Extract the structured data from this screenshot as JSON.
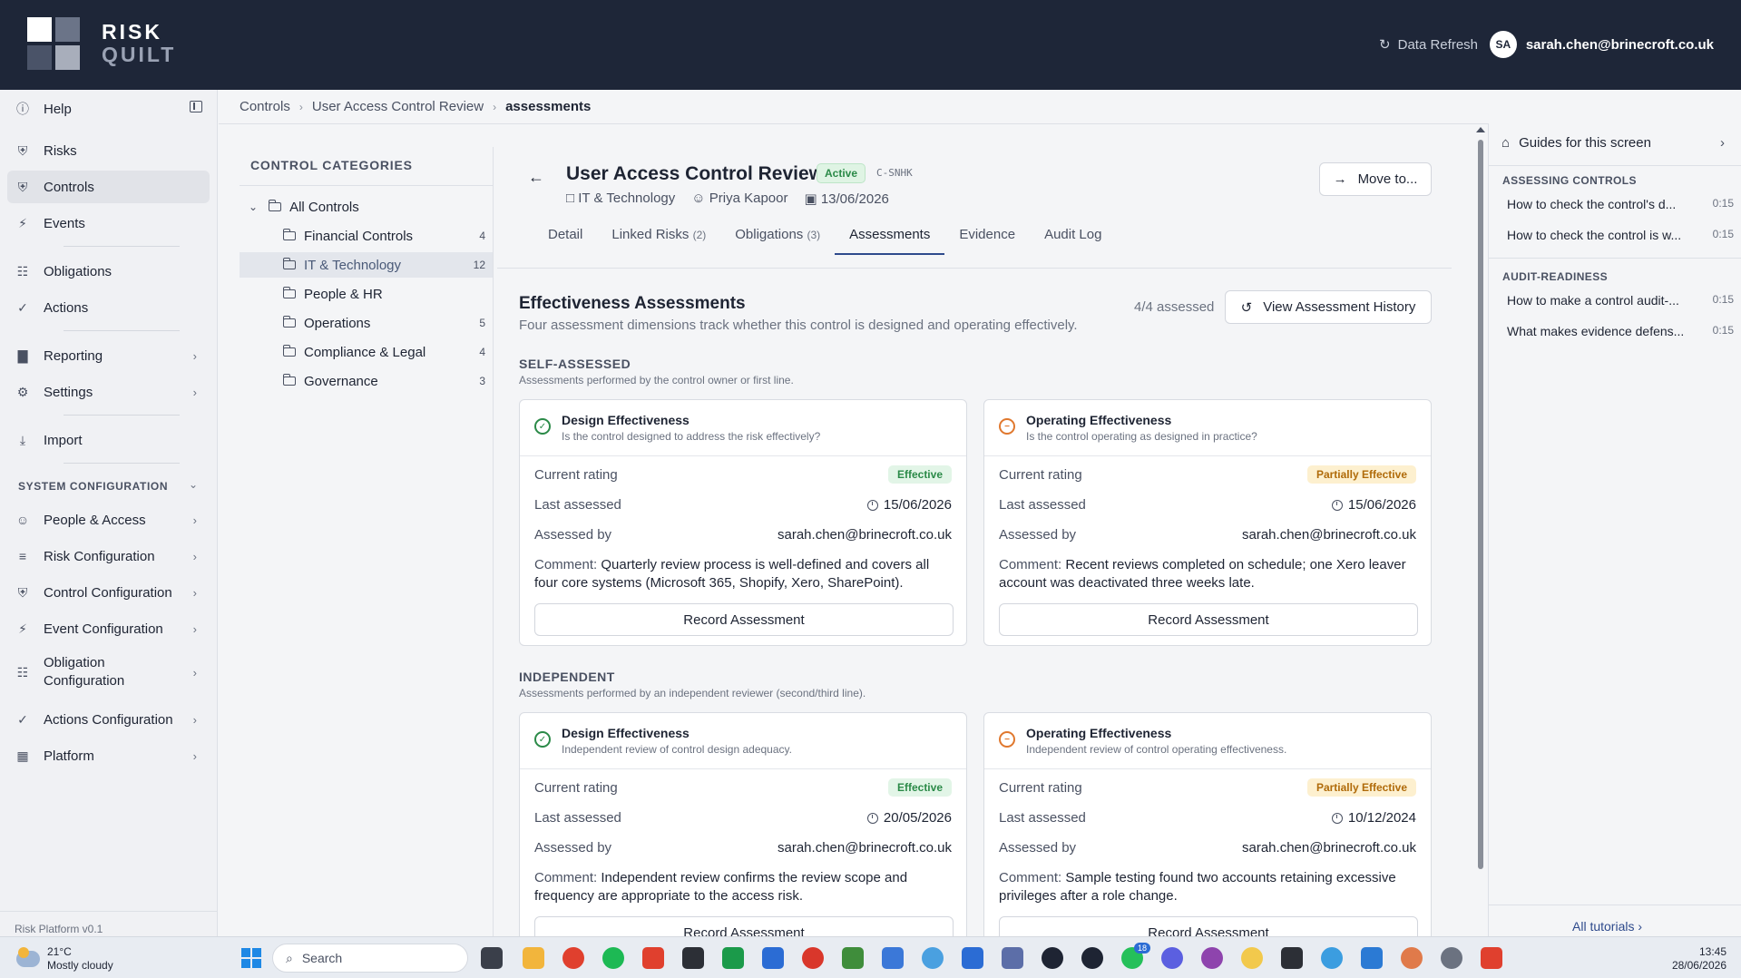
{
  "app": {
    "logo_line1": "RISK",
    "logo_line2": "QUILT",
    "refresh_label": "Data Refresh",
    "user_initials": "SA",
    "user_email": "sarah.chen@brinecroft.co.uk"
  },
  "sidebar": {
    "help": "Help",
    "items": [
      {
        "label": "Risks",
        "icon": "shield-icon"
      },
      {
        "label": "Controls",
        "icon": "shield-icon"
      },
      {
        "label": "Events",
        "icon": "bolt-icon"
      },
      {
        "label": "Obligations",
        "icon": "clipboard-icon"
      },
      {
        "label": "Actions",
        "icon": "check-circle-icon"
      },
      {
        "label": "Reporting",
        "icon": "bar-chart-icon"
      },
      {
        "label": "Settings",
        "icon": "gear-icon"
      },
      {
        "label": "Import",
        "icon": "import-icon"
      }
    ],
    "section_title": "SYSTEM CONFIGURATION",
    "config_items": [
      {
        "label": "People & Access",
        "icon": "users-icon"
      },
      {
        "label": "Risk Configuration",
        "icon": "layers-icon"
      },
      {
        "label": "Control Configuration",
        "icon": "shield-icon"
      },
      {
        "label": "Event Configuration",
        "icon": "bolt-icon"
      },
      {
        "label": "Obligation Configuration",
        "icon": "clipboard-icon"
      },
      {
        "label": "Actions Configuration",
        "icon": "check-circle-icon"
      },
      {
        "label": "Platform",
        "icon": "building-icon"
      }
    ],
    "footer": "Risk Platform v0.1"
  },
  "breadcrumb": [
    "Controls",
    "User Access Control Review",
    "assessments"
  ],
  "categories": {
    "title": "CONTROL CATEGORIES",
    "all": "All Controls",
    "items": [
      {
        "label": "Financial Controls",
        "count": "4"
      },
      {
        "label": "IT & Technology",
        "count": "12"
      },
      {
        "label": "People & HR",
        "count": ""
      },
      {
        "label": "Operations",
        "count": "5"
      },
      {
        "label": "Compliance & Legal",
        "count": "4"
      },
      {
        "label": "Governance",
        "count": "3"
      }
    ]
  },
  "control": {
    "title": "User Access Control Review",
    "status": "Active",
    "code": "C-SNHK",
    "category": "IT & Technology",
    "owner": "Priya Kapoor",
    "date": "13/06/2026",
    "move_label": "Move to..."
  },
  "tabs": [
    {
      "label": "Detail",
      "count": ""
    },
    {
      "label": "Linked Risks",
      "count": "(2)"
    },
    {
      "label": "Obligations",
      "count": "(3)"
    },
    {
      "label": "Assessments",
      "count": ""
    },
    {
      "label": "Evidence",
      "count": ""
    },
    {
      "label": "Audit Log",
      "count": ""
    }
  ],
  "assessments": {
    "title": "Effectiveness Assessments",
    "subtitle": "Four assessment dimensions track whether this control is designed and operating effectively.",
    "assessed": "4/4 assessed",
    "history_label": "View Assessment History",
    "labels": {
      "rating": "Current rating",
      "last": "Last assessed",
      "by": "Assessed by",
      "comment": "Comment:",
      "record": "Record Assessment"
    },
    "self": {
      "title": "SELF-ASSESSED",
      "subtitle": "Assessments performed by the control owner or first line.",
      "cards": [
        {
          "title": "Design Effectiveness",
          "question": "Is the control designed to address the risk effectively?",
          "rating": "Effective",
          "last": "15/06/2026",
          "by": "sarah.chen@brinecroft.co.uk",
          "comment": "Quarterly review process is well-defined and covers all four core systems (Microsoft 365, Shopify, Xero, SharePoint)."
        },
        {
          "title": "Operating Effectiveness",
          "question": "Is the control operating as designed in practice?",
          "rating": "Partially Effective",
          "last": "15/06/2026",
          "by": "sarah.chen@brinecroft.co.uk",
          "comment": "Recent reviews completed on schedule; one Xero leaver account was deactivated three weeks late."
        }
      ]
    },
    "independent": {
      "title": "INDEPENDENT",
      "subtitle": "Assessments performed by an independent reviewer (second/third line).",
      "cards": [
        {
          "title": "Design Effectiveness",
          "question": "Independent review of control design adequacy.",
          "rating": "Effective",
          "last": "20/05/2026",
          "by": "sarah.chen@brinecroft.co.uk",
          "comment": "Independent review confirms the review scope and frequency are appropriate to the access risk."
        },
        {
          "title": "Operating Effectiveness",
          "question": "Independent review of control operating effectiveness.",
          "rating": "Partially Effective",
          "last": "10/12/2024",
          "by": "sarah.chen@brinecroft.co.uk",
          "comment": "Sample testing found two accounts retaining excessive privileges after a role change."
        }
      ]
    }
  },
  "guides": {
    "title": "Guides for this screen",
    "section1": "ASSESSING CONTROLS",
    "section1_items": [
      {
        "label": "How to check the control's d...",
        "dur": "0:15"
      },
      {
        "label": "How to check the control is w...",
        "dur": "0:15"
      }
    ],
    "section2": "AUDIT-READINESS",
    "section2_items": [
      {
        "label": "How to make a control audit-...",
        "dur": "0:15"
      },
      {
        "label": "What makes evidence defens...",
        "dur": "0:15"
      }
    ],
    "footer": "All tutorials"
  },
  "taskbar": {
    "temp": "21°C",
    "weather": "Mostly cloudy",
    "search": "Search",
    "badge": "18",
    "time": "13:45",
    "date": "28/06/2026"
  }
}
